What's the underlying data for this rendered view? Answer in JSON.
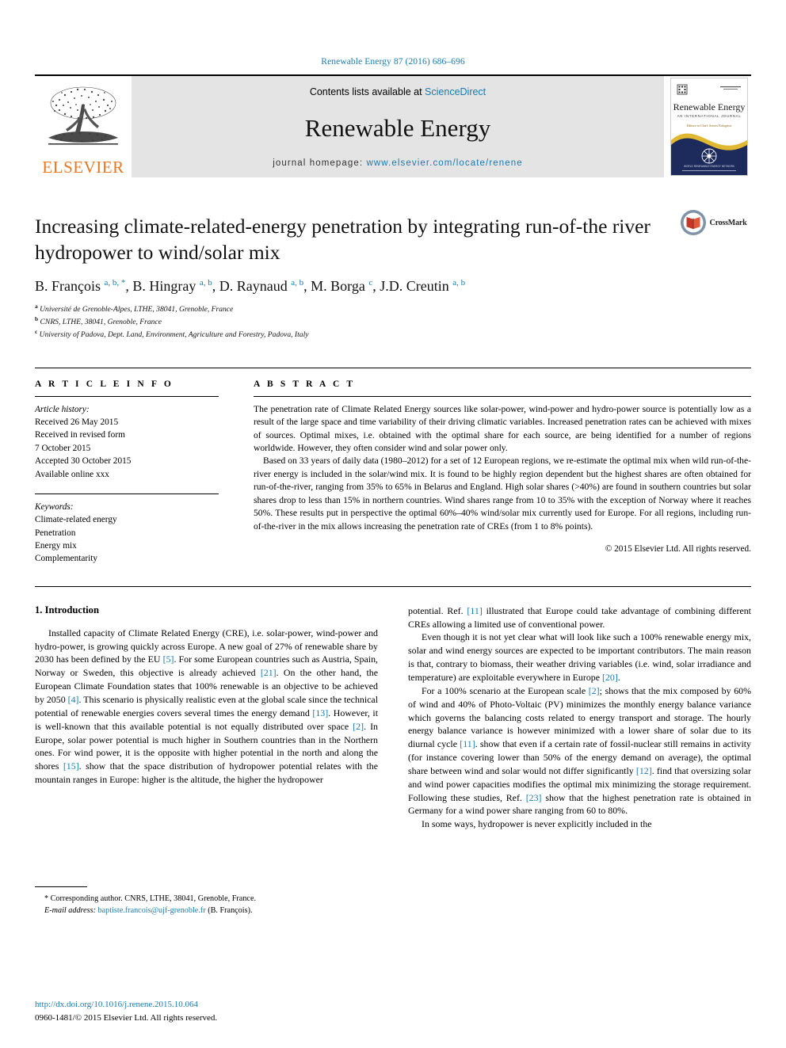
{
  "running_head": "Renewable Energy 87 (2016) 686–696",
  "masthead": {
    "publisher": "ELSEVIER",
    "contents_prefix": "Contents lists available at ",
    "contents_link": "ScienceDirect",
    "journal_title": "Renewable Energy",
    "homepage_prefix": "journal homepage: ",
    "homepage_url": "www.elsevier.com/locate/renene",
    "cover": {
      "title": "Renewable Energy",
      "subtitle": "AN INTERNATIONAL JOURNAL",
      "editors": "Editors-in-Chief: Soteris Kalogirou"
    }
  },
  "article": {
    "title": "Increasing climate-related-energy penetration by integrating run-of-the river hydropower to wind/solar mix",
    "crossmark_label": "CrossMark",
    "authors_html": "B. François <sup>a, b, *</sup>, B. Hingray <sup>a, b</sup>, D. Raynaud <sup>a, b</sup>, M. Borga <sup>c</sup>, J.D. Creutin <sup>a, b</sup>",
    "affiliations": [
      {
        "mark": "a",
        "text": "Université de Grenoble-Alpes, LTHE, 38041, Grenoble, France"
      },
      {
        "mark": "b",
        "text": "CNRS, LTHE, 38041, Grenoble, France"
      },
      {
        "mark": "c",
        "text": "University of Padova, Dept. Land, Environment, Agriculture and Forestry, Padova, Italy"
      }
    ]
  },
  "article_info": {
    "heading": "A R T I C L E   I N F O",
    "history_label": "Article history:",
    "history": [
      "Received 26 May 2015",
      "Received in revised form",
      "7 October 2015",
      "Accepted 30 October 2015",
      "Available online xxx"
    ],
    "keywords_label": "Keywords:",
    "keywords": [
      "Climate-related energy",
      "Penetration",
      "Energy mix",
      "Complementarity"
    ]
  },
  "abstract": {
    "heading": "A B S T R A C T",
    "paragraph_1": "The penetration rate of Climate Related Energy sources like solar-power, wind-power and hydro-power source is potentially low as a result of the large space and time variability of their driving climatic variables. Increased penetration rates can be achieved with mixes of sources. Optimal mixes, i.e. obtained with the optimal share for each source, are being identified for a number of regions worldwide. However, they often consider wind and solar power only.",
    "paragraph_2": "Based on 33 years of daily data (1980–2012) for a set of 12 European regions, we re-estimate the optimal mix when wild run-of-the-river energy is included in the solar/wind mix. It is found to be highly region dependent but the highest shares are often obtained for run-of-the-river, ranging from 35% to 65% in Belarus and England. High solar shares (>40%) are found in southern countries but solar shares drop to less than 15% in northern countries. Wind shares range from 10 to 35% with the exception of Norway where it reaches 50%. These results put in perspective the optimal 60%–40% wind/solar mix currently used for Europe. For all regions, including run-of-the-river in the mix allows increasing the penetration rate of CREs (from 1 to 8% points).",
    "copyright": "© 2015 Elsevier Ltd. All rights reserved."
  },
  "introduction": {
    "heading": "1. Introduction",
    "left_paragraph_1": "Installed capacity of Climate Related Energy (CRE), i.e. solar-power, wind-power and hydro-power, is growing quickly across Europe. A new goal of 27% of renewable share by 2030 has been defined by the EU [5]. For some European countries such as Austria, Spain, Norway or Sweden, this objective is already achieved [21]. On the other hand, the European Climate Foundation states that 100% renewable is an objective to be achieved by 2050 [4]. This scenario is physically realistic even at the global scale since the technical potential of renewable energies covers several times the energy demand [13]. However, it is well-known that this available potential is not equally distributed over space [2]. In Europe, solar power potential is much higher in Southern countries than in the Northern ones. For wind power, it is the opposite with higher potential in the north and along the shores [15]. show that the space distribution of hydropower potential relates with the mountain ranges in Europe: higher is the altitude, the higher the hydropower",
    "right_paragraph_1": "potential. Ref. [11] illustrated that Europe could take advantage of combining different CREs allowing a limited use of conventional power.",
    "right_paragraph_2": "Even though it is not yet clear what will look like such a 100% renewable energy mix, solar and wind energy sources are expected to be important contributors. The main reason is that, contrary to biomass, their weather driving variables (i.e. wind, solar irradiance and temperature) are exploitable everywhere in Europe [20].",
    "right_paragraph_3": "For a 100% scenario at the European scale [2]; shows that the mix composed by 60% of wind and 40% of Photo-Voltaic (PV) minimizes the monthly energy balance variance which governs the balancing costs related to energy transport and storage. The hourly energy balance variance is however minimized with a lower share of solar due to its diurnal cycle [11]. show that even if a certain rate of fossil-nuclear still remains in activity (for instance covering lower than 50% of the energy demand on average), the optimal share between wind and solar would not differ significantly [12]. find that oversizing solar and wind power capacities modifies the optimal mix minimizing the storage requirement. Following these studies, Ref. [23] show that the highest penetration rate is obtained in Germany for a wind power share ranging from 60 to 80%.",
    "right_paragraph_4": "In some ways, hydropower is never explicitly included in the"
  },
  "footnote": {
    "corresponding": "* Corresponding author. CNRS, LTHE, 38041, Grenoble, France.",
    "email_label": "E-mail address:",
    "email": "baptiste.francois@ujf-grenoble.fr",
    "email_suffix": "(B. François)."
  },
  "doi_block": {
    "doi_url": "http://dx.doi.org/10.1016/j.renene.2015.10.064",
    "issn_line": "0960-1481/© 2015 Elsevier Ltd. All rights reserved."
  },
  "colors": {
    "link": "#1a7ab0",
    "elsevier_orange": "#E87722",
    "masthead_bg": "#e4e4e4",
    "cover_navy": "#1d2b5c",
    "cover_gold": "#e0b832",
    "crossmark_blue": "#4a6b8a",
    "crossmark_red": "#c0392b"
  }
}
